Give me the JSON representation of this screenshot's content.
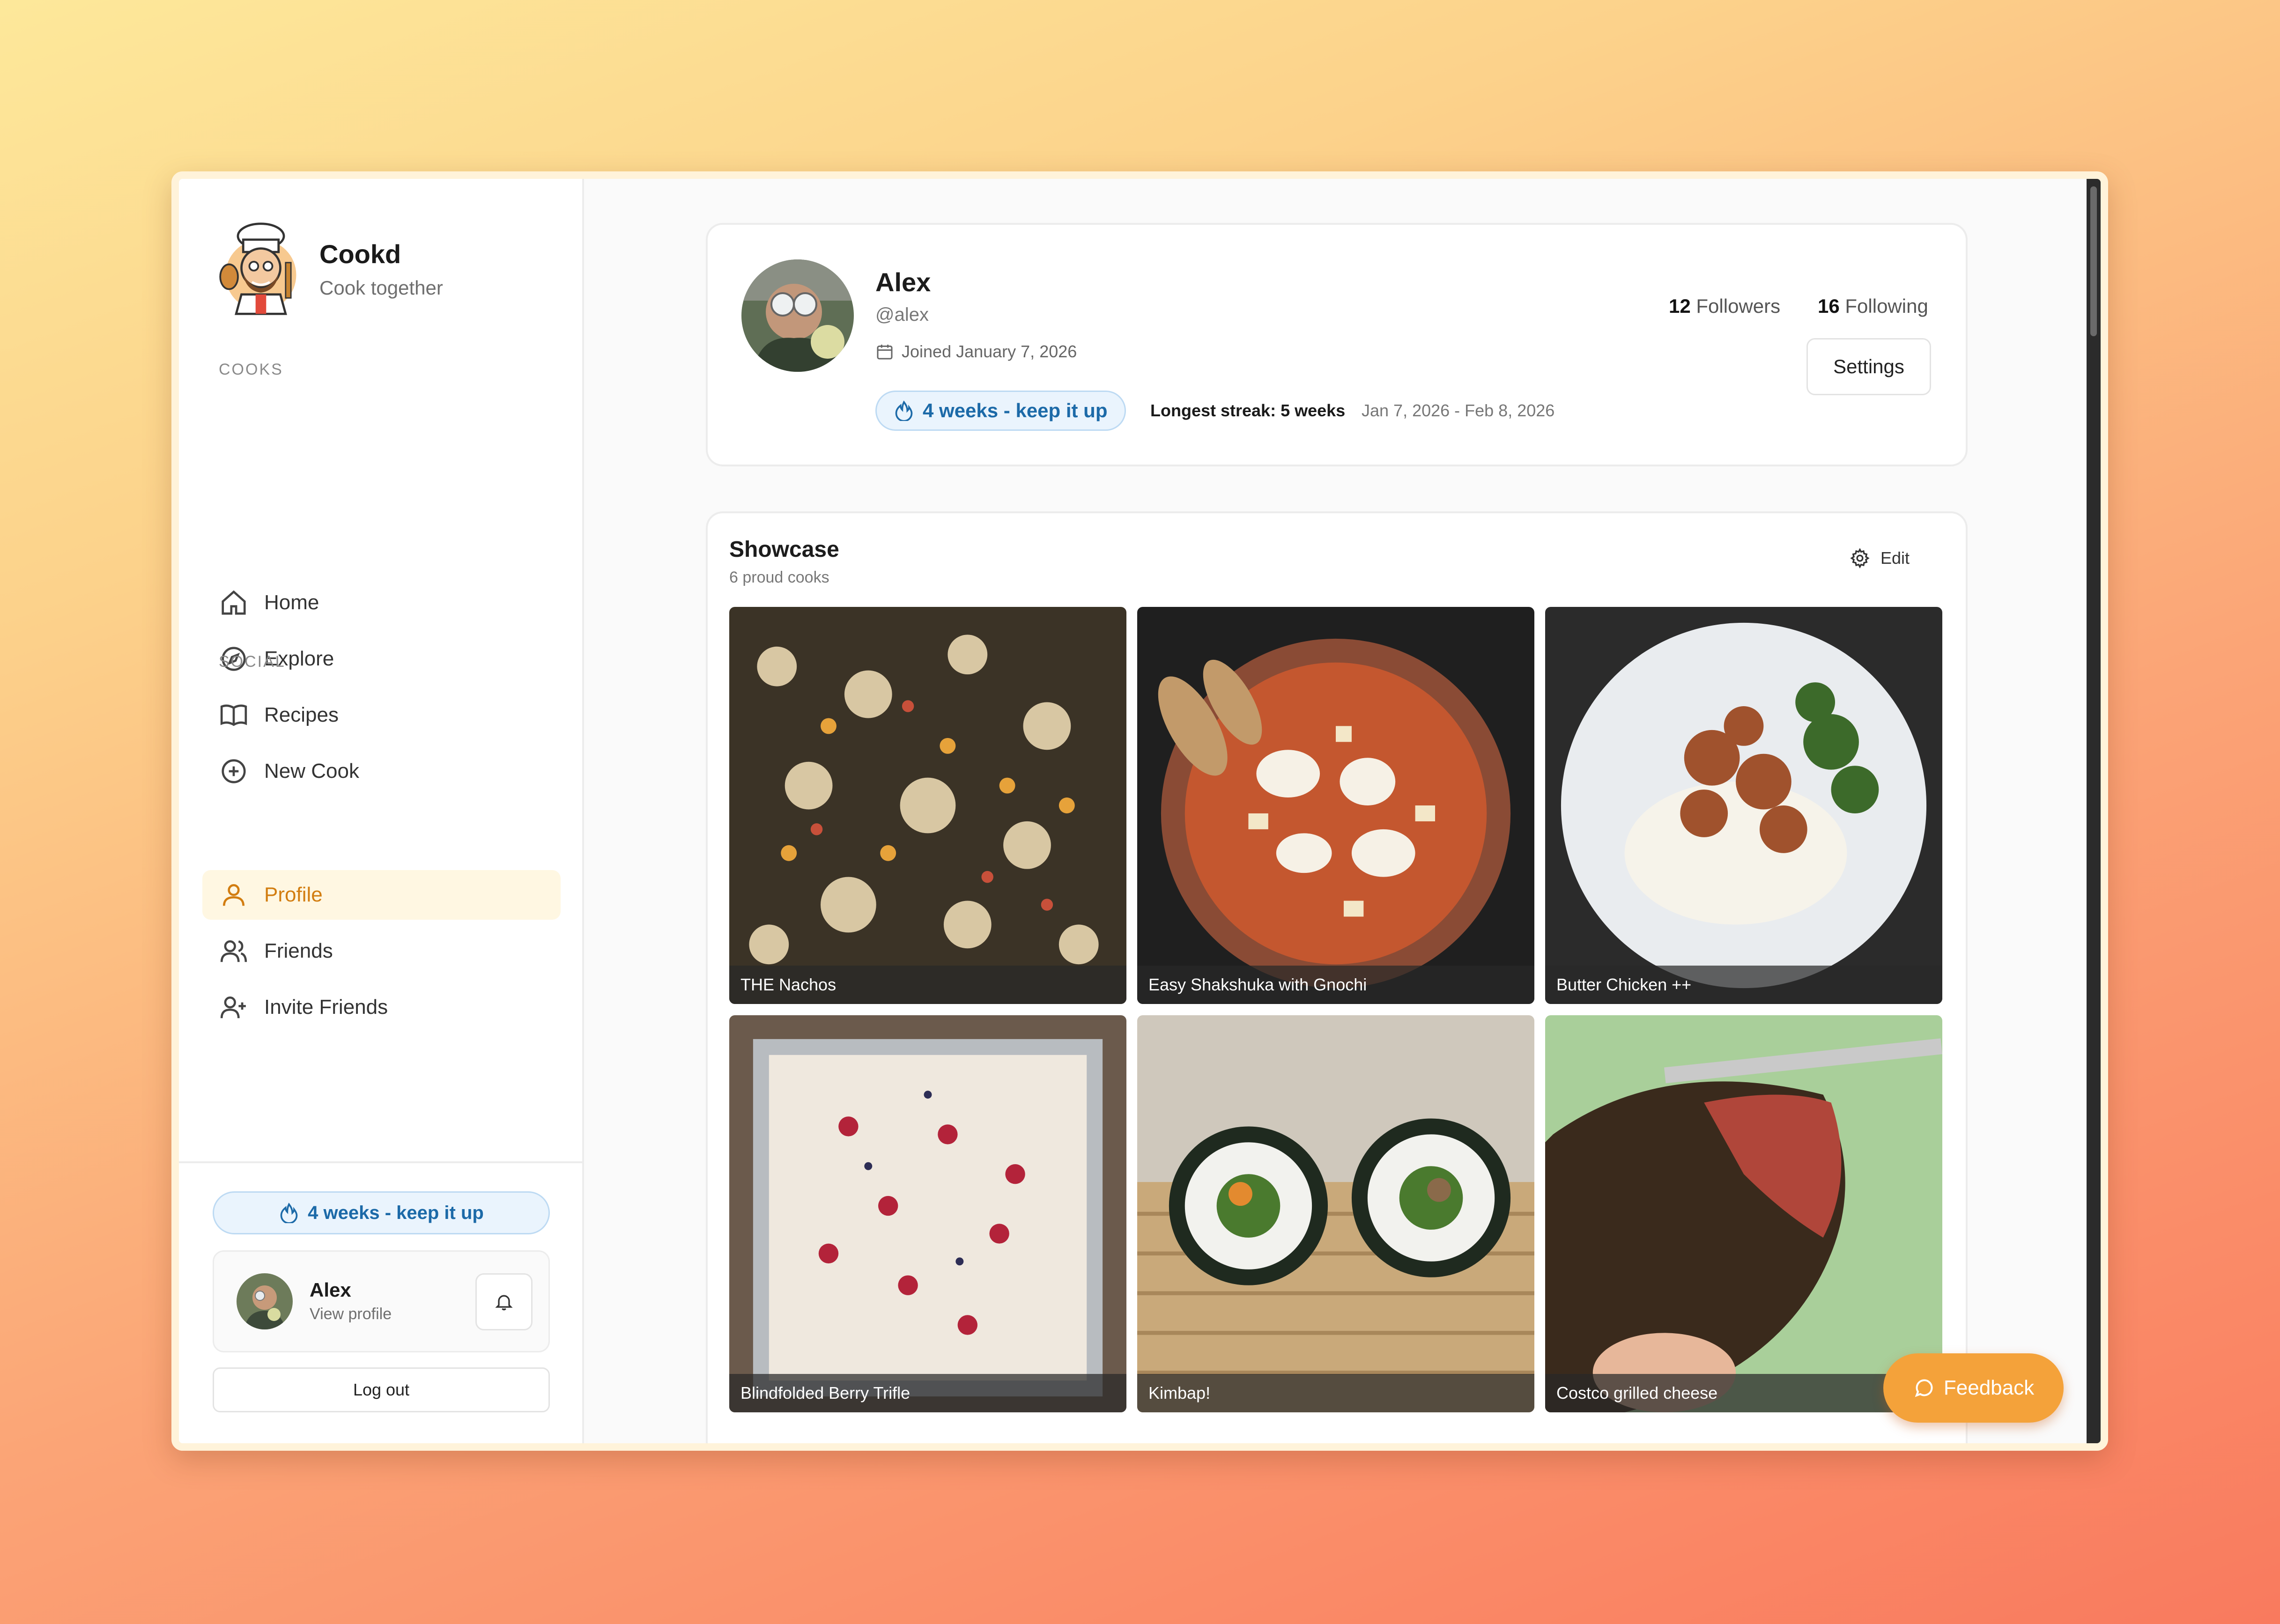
{
  "brand": {
    "name": "Cookd",
    "tagline": "Cook together"
  },
  "sidebar": {
    "section_cooks": "COOKS",
    "cooks_items": [
      {
        "label": "Home",
        "icon": "home-icon"
      },
      {
        "label": "Explore",
        "icon": "compass-icon"
      },
      {
        "label": "Recipes",
        "icon": "book-icon"
      },
      {
        "label": "New Cook",
        "icon": "plus-circle-icon"
      }
    ],
    "section_social": "SOCIAL",
    "social_items": [
      {
        "label": "Profile",
        "icon": "user-icon",
        "active": true
      },
      {
        "label": "Friends",
        "icon": "users-icon"
      },
      {
        "label": "Invite Friends",
        "icon": "user-plus-icon"
      }
    ],
    "streak": "4 weeks - keep it up",
    "user": {
      "name": "Alex",
      "link": "View profile"
    },
    "logout": "Log out"
  },
  "profile": {
    "name": "Alex",
    "handle": "@alex",
    "joined": "Joined January 7, 2026",
    "streak": "4 weeks - keep it up",
    "longest": "Longest streak: 5 weeks",
    "range": "Jan 7, 2026 - Feb 8, 2026",
    "followers_count": "12",
    "followers_label": "Followers",
    "following_count": "16",
    "following_label": "Following",
    "settings": "Settings"
  },
  "showcase": {
    "title": "Showcase",
    "subtitle": "6 proud cooks",
    "edit": "Edit",
    "items": [
      "THE Nachos",
      "Easy Shakshuka with Gnochi",
      "Butter Chicken ++",
      "Blindfolded Berry Trifle",
      "Kimbap!",
      "Costco grilled cheese"
    ]
  },
  "feedback": "Feedback",
  "colors": {
    "accent": "#f4a23a",
    "active_nav": "#d27d10",
    "streak_blue": "#1c6aa8"
  }
}
